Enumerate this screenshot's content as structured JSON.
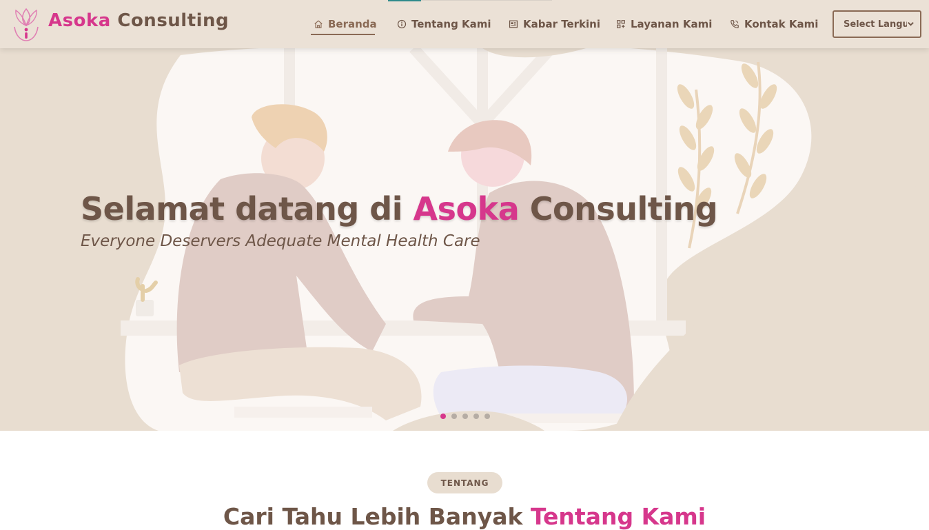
{
  "header": {
    "brand_part1": "Asoka",
    "brand_part2": "Consulting",
    "nav": [
      {
        "label": "Beranda",
        "icon": "home-icon",
        "active": true
      },
      {
        "label": "Tentang Kami",
        "icon": "info-icon"
      },
      {
        "label": "Kabar Terkini",
        "icon": "newspaper-icon"
      },
      {
        "label": "Layanan Kami",
        "icon": "grid-plus-icon"
      },
      {
        "label": "Kontak Kami",
        "icon": "phone-icon"
      }
    ],
    "language_select": "Select Language"
  },
  "hero": {
    "title_part1": "Selamat datang di",
    "title_highlight": "Asoka",
    "title_part2": "Consulting",
    "subtitle": "Everyone Deservers Adequate Mental Health Care",
    "slides_count": 5,
    "active_slide": 1
  },
  "about": {
    "badge": "TENTANG",
    "title_part1": "Cari Tahu Lebih Banyak",
    "title_highlight": "Tentang Kami"
  },
  "colors": {
    "accent_pink": "#d6378c",
    "brown_text": "#6e5648",
    "header_bg": "#ebe1d6",
    "hero_bg": "#e8ddd0"
  }
}
